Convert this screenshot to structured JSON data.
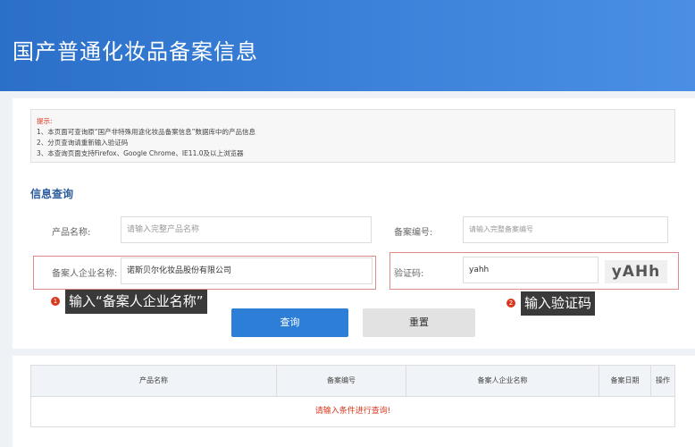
{
  "header": {
    "title": "国产普通化妆品备案信息"
  },
  "notice": {
    "title": "提示:",
    "lines": [
      "1、本页面可查询原“国产非特殊用途化妆品备案信息”数据库中的产品信息",
      "2、分页查询请重新输入验证码",
      "3、本查询页面支持Firefox、Google Chrome、IE11.0及以上浏览器"
    ]
  },
  "section": {
    "title": "信息查询"
  },
  "form": {
    "product_name": {
      "label": "产品名称:",
      "placeholder": "请输入完整产品名称"
    },
    "record_no": {
      "label": "备案编号:",
      "placeholder": "请输入完整备案编号"
    },
    "company": {
      "label": "备案人企业名称:",
      "value": "诺斯贝尔化妆品股份有限公司"
    },
    "captcha": {
      "label": "验证码:",
      "value": "yahh",
      "image_text": "yAHh"
    }
  },
  "callouts": [
    {
      "badge": "1",
      "text": "输入“备案人企业名称”"
    },
    {
      "badge": "2",
      "text": "输入验证码"
    }
  ],
  "buttons": {
    "query": "查询",
    "reset": "重置"
  },
  "table": {
    "headers": [
      "产品名称",
      "备案编号",
      "备案人企业名称",
      "备案日期",
      "操作"
    ],
    "empty_message": "请输入条件进行查询!"
  }
}
